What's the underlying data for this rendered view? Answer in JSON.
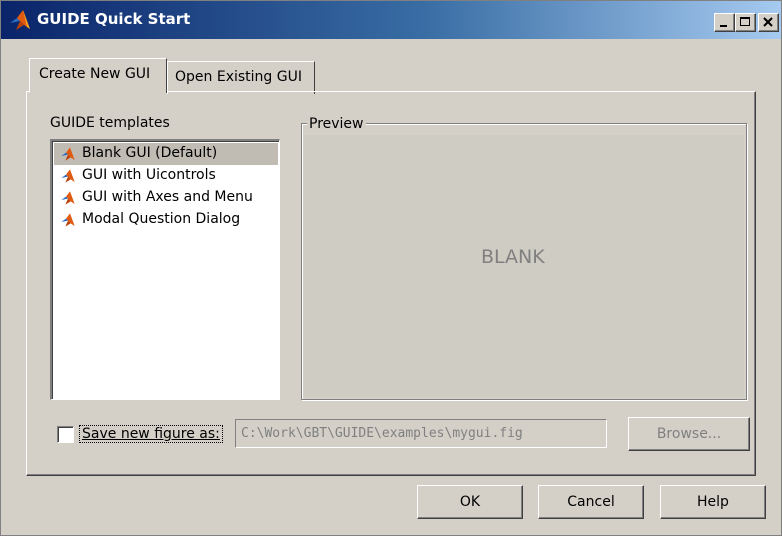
{
  "window": {
    "title": "GUIDE Quick Start"
  },
  "tabs": [
    {
      "label": "Create New GUI",
      "active": true
    },
    {
      "label": "Open Existing GUI",
      "active": false
    }
  ],
  "templates": {
    "heading": "GUIDE templates",
    "items": [
      {
        "label": "Blank GUI (Default)",
        "selected": true,
        "icon": "matlab-icon"
      },
      {
        "label": "GUI with Uicontrols",
        "selected": false,
        "icon": "matlab-icon"
      },
      {
        "label": "GUI with Axes and Menu",
        "selected": false,
        "icon": "matlab-icon"
      },
      {
        "label": "Modal Question Dialog",
        "selected": false,
        "icon": "matlab-icon"
      }
    ]
  },
  "preview": {
    "caption": "Preview",
    "text": "BLANK"
  },
  "save": {
    "checkbox_label": "Save new figure as:",
    "checked": false,
    "path_value": "C:\\Work\\GBT\\GUIDE\\examples\\mygui.fig",
    "browse_label": "Browse..."
  },
  "buttons": {
    "ok": "OK",
    "cancel": "Cancel",
    "help": "Help"
  },
  "colors": {
    "face": "#d4d0c8",
    "titlebar_start": "#0a246a",
    "titlebar_end": "#a6caf0",
    "selection": "#c0bcb4",
    "disabled_text": "#808080"
  }
}
